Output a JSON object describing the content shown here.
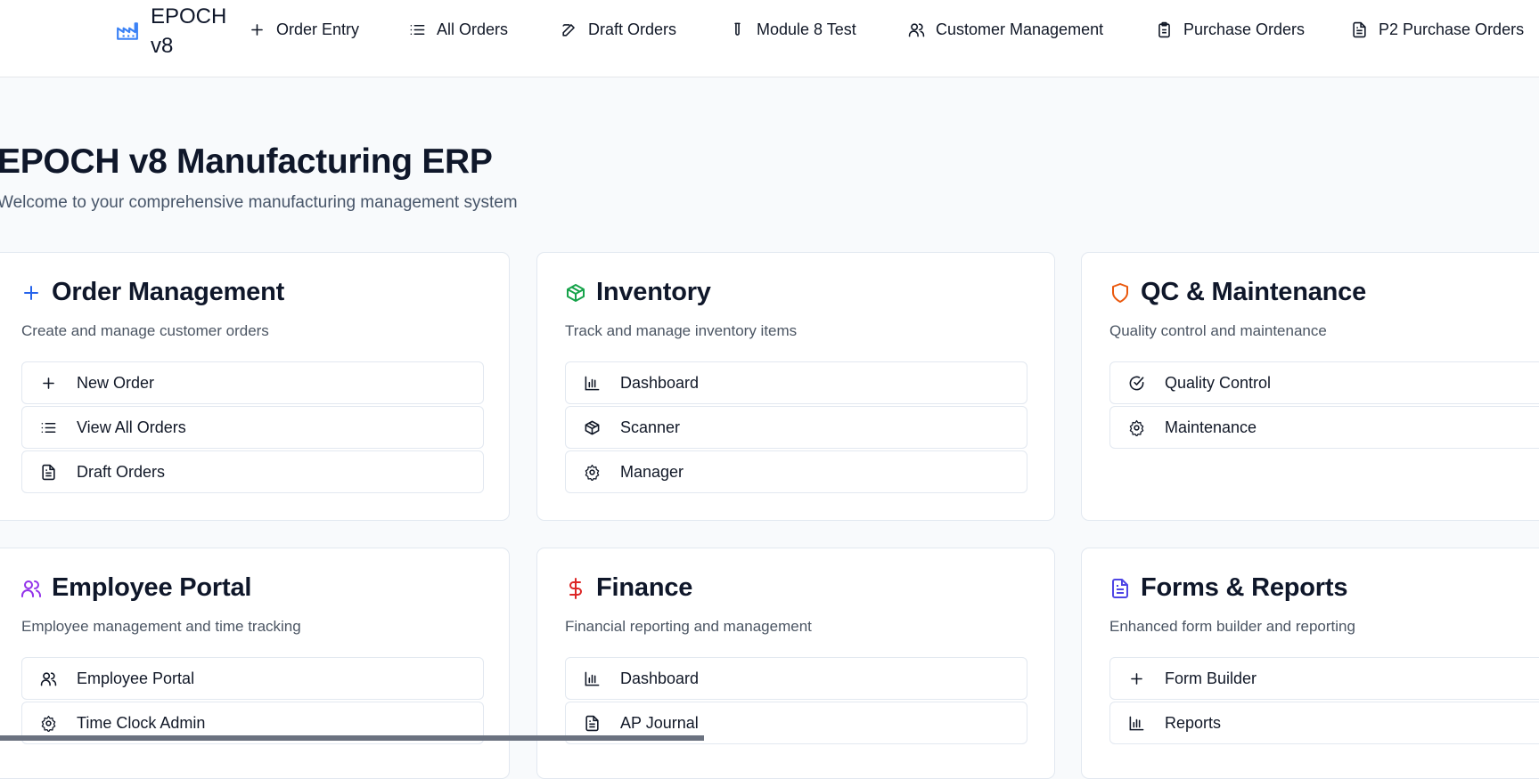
{
  "nav": {
    "brand": "EPOCH v8",
    "items": [
      {
        "label": "Order Entry",
        "icon": "plus-icon"
      },
      {
        "label": "All Orders",
        "icon": "list-icon"
      },
      {
        "label": "Draft Orders",
        "icon": "edit-icon"
      },
      {
        "label": "Module 8 Test",
        "icon": "test-tube-icon"
      },
      {
        "label": "Customer Management",
        "icon": "users-icon"
      },
      {
        "label": "Purchase Orders",
        "icon": "clipboard-icon"
      },
      {
        "label": "P2 Purchase Orders",
        "icon": "file-text-icon"
      }
    ]
  },
  "hero": {
    "title": "EPOCH v8 Manufacturing ERP",
    "subtitle": "Welcome to your comprehensive manufacturing management system"
  },
  "cards": [
    {
      "title": "Order Management",
      "description": "Create and manage customer orders",
      "icon": "plus-icon",
      "color": "#2563eb",
      "links": [
        {
          "label": "New Order",
          "icon": "plus-icon"
        },
        {
          "label": "View All Orders",
          "icon": "list-icon"
        },
        {
          "label": "Draft Orders",
          "icon": "file-text-icon"
        }
      ]
    },
    {
      "title": "Inventory",
      "description": "Track and manage inventory items",
      "icon": "package-icon",
      "color": "#16a34a",
      "links": [
        {
          "label": "Dashboard",
          "icon": "bar-chart-icon"
        },
        {
          "label": "Scanner",
          "icon": "package-icon"
        },
        {
          "label": "Manager",
          "icon": "gear-icon"
        }
      ]
    },
    {
      "title": "QC & Maintenance",
      "description": "Quality control and maintenance",
      "icon": "shield-icon",
      "color": "#ea580c",
      "links": [
        {
          "label": "Quality Control",
          "icon": "check-circle-icon"
        },
        {
          "label": "Maintenance",
          "icon": "gear-icon"
        }
      ]
    },
    {
      "title": "Employee Portal",
      "description": "Employee management and time tracking",
      "icon": "users-icon",
      "color": "#9333ea",
      "links": [
        {
          "label": "Employee Portal",
          "icon": "users-icon"
        },
        {
          "label": "Time Clock Admin",
          "icon": "gear-icon"
        }
      ]
    },
    {
      "title": "Finance",
      "description": "Financial reporting and management",
      "icon": "dollar-icon",
      "color": "#dc2626",
      "links": [
        {
          "label": "Dashboard",
          "icon": "bar-chart-icon"
        },
        {
          "label": "AP Journal",
          "icon": "file-text-icon"
        }
      ]
    },
    {
      "title": "Forms & Reports",
      "description": "Enhanced form builder and reporting",
      "icon": "file-text-icon",
      "color": "#4f46e5",
      "links": [
        {
          "label": "Form Builder",
          "icon": "plus-icon"
        },
        {
          "label": "Reports",
          "icon": "bar-chart-icon"
        }
      ]
    }
  ]
}
